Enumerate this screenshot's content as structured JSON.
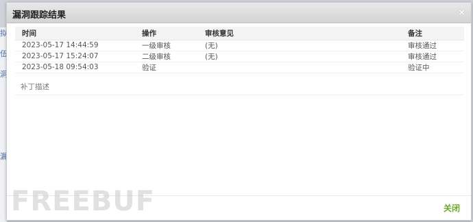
{
  "dialog": {
    "title": "漏洞跟踪结果",
    "close_icon": "×",
    "close_button_label": "关闭"
  },
  "table": {
    "headers": [
      "时间",
      "操作",
      "审核意见",
      "备注"
    ],
    "rows": [
      [
        "2023-05-17 14:44:59",
        "一级审核",
        "(无)",
        "审核通过"
      ],
      [
        "2023-05-17 15:24:07",
        "二级审核",
        "(无)",
        "审核通过"
      ],
      [
        "2023-05-18 09:54:03",
        "验证",
        "",
        "验证中"
      ]
    ]
  },
  "supplement_label": "补丁描述",
  "watermark": "FREEBUF",
  "colors": {
    "close_button": "#6aaa2a",
    "titlebar": "#dcdcdc"
  }
}
